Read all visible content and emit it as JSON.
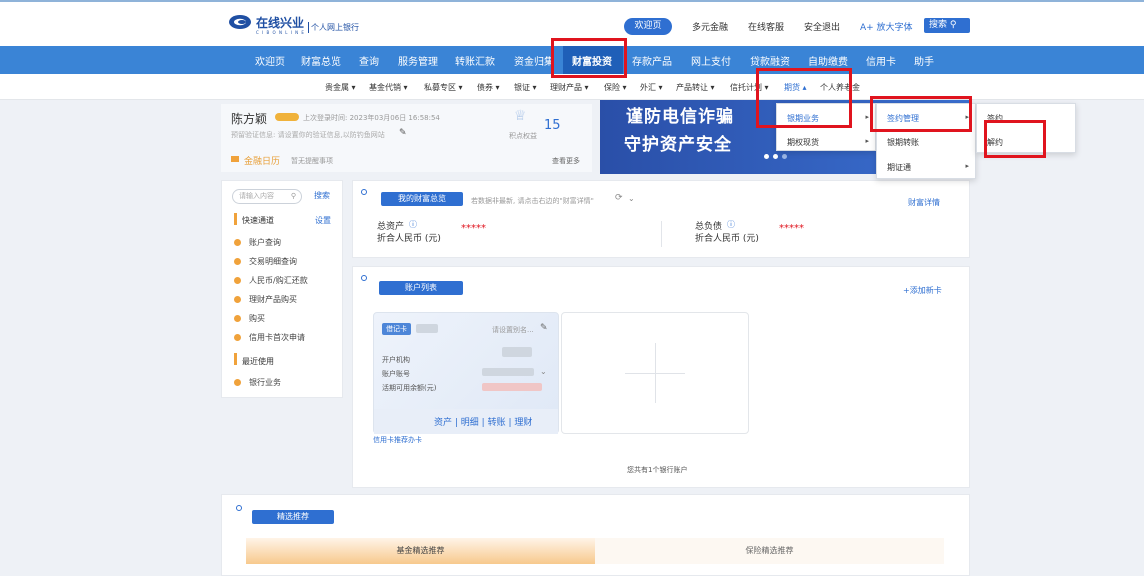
{
  "header": {
    "logo_text": "在线兴业",
    "logo_sub": "个人网上银行",
    "logo_eng": "C I B  O N L I N E",
    "links": {
      "welcome": "欢迎页",
      "diverse": "多元金融",
      "service": "在线客服",
      "logout": "安全退出",
      "font": "A+ 放大字体",
      "search": "搜索"
    }
  },
  "nav": [
    "欢迎页",
    "财富总览",
    "查询",
    "服务管理",
    "转账汇款",
    "资金归集",
    "财富投资",
    "存款产品",
    "网上支付",
    "贷款融资",
    "自助缴费",
    "信用卡",
    "助手"
  ],
  "subnav": [
    "贵金属 ▾",
    "基金代销 ▾",
    "私募专区 ▾",
    "债券 ▾",
    "银证 ▾",
    "理财产品 ▾",
    "保险 ▾",
    "外汇 ▾",
    "产品转让 ▾",
    "信托计划 ▾",
    "期货 ▴",
    "个人养老金"
  ],
  "user": {
    "name": "陈方颖",
    "last_login": "上次登录时间: 2023年03月06日 16:58:54",
    "verify": "预留验证信息: 请设置你的验证信息,以防钓鱼网站",
    "points": "15",
    "points_label": "积点权益",
    "calendar": "金融日历",
    "calendar_note": "暂无提醒事项",
    "more": "查看更多"
  },
  "banner": {
    "line1": "谨防电信诈骗",
    "line2": "守护资产安全"
  },
  "dropdown1": [
    "银期业务",
    "期权现货"
  ],
  "dropdown2": [
    "签约管理",
    "银期转账",
    "期证通"
  ],
  "dropdown3": [
    "签约",
    "解约"
  ],
  "sidebar": {
    "search_placeholder": "请输入内容",
    "search_btn": "搜索",
    "quick": "快速通道",
    "settings": "设置",
    "items": [
      "账户查询",
      "交易明细查询",
      "人民币/购汇还款",
      "理财产品购买",
      "购买",
      "信用卡首次申请"
    ],
    "recent": "最近使用",
    "recent_items": [
      "银行业务"
    ]
  },
  "wealth": {
    "title": "我的财富总览",
    "note": "若数据非最新, 请点击右边的\"财富详情\"",
    "detail": "财富详情",
    "assets": "总资产",
    "assets_sub": "折合人民币 (元)",
    "assets_val": "*****",
    "debts": "总负债",
    "debts_sub": "折合人民币 (元)",
    "debts_val": "*****"
  },
  "accounts": {
    "title": "账户列表",
    "add": "+添加新卡",
    "card_tag": "借记卡",
    "alias": "请设置别名...",
    "org": "开户机构",
    "acct": "账户账号",
    "balance": "活期可用余额(元)",
    "actions": [
      "资产",
      "明细",
      "转账",
      "理财"
    ],
    "credit": "信用卡推荐办卡",
    "count": "您共有1个银行账户"
  },
  "recommend": {
    "title": "精选推荐",
    "tab1": "基金精选推荐",
    "tab2": "保险精选推荐"
  },
  "colors": {
    "nav": "#3a84d6",
    "primary": "#2f6fd1",
    "highlight": "#e0141e"
  }
}
